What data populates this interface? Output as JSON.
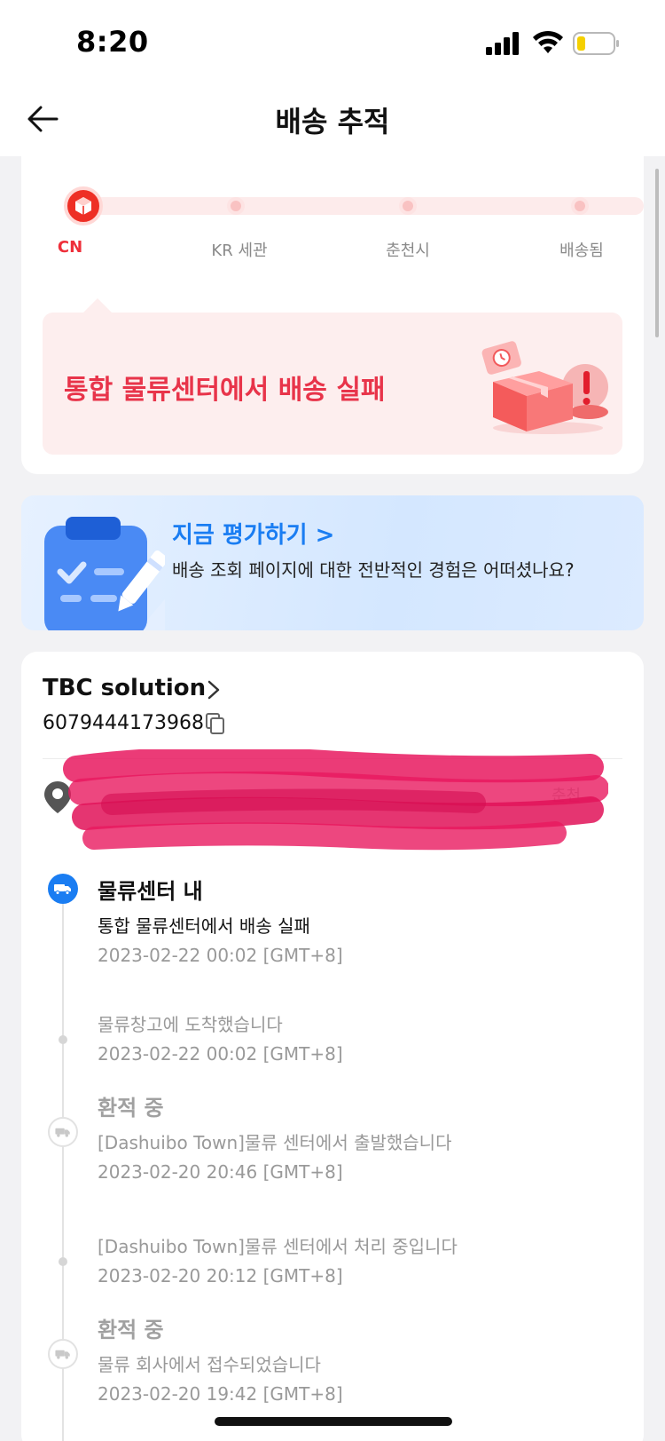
{
  "status_bar": {
    "time": "8:20"
  },
  "nav": {
    "title": "배송 추적"
  },
  "progress": {
    "steps": [
      "CN",
      "KR 세관",
      "춘천시",
      "배송됨"
    ],
    "status_message": "통합 물류센터에서 배송 실패"
  },
  "review": {
    "title": "지금 평가하기 >",
    "subtitle": "배송 조회 페이지에 대한 전반적인 경험은 어떠셨나요?"
  },
  "shipment": {
    "carrier": "TBC solution",
    "tracking_number": "6079444173968",
    "address_tail": "춘천"
  },
  "timeline": [
    {
      "title": "물류센터 내",
      "desc": "통합 물류센터에서 배송 실패",
      "time": "2023-02-22 00:02 [GMT+8]"
    },
    {
      "title": "",
      "desc": "물류창고에 도착했습니다",
      "time": "2023-02-22 00:02 [GMT+8]"
    },
    {
      "title": "환적 중",
      "desc": "[Dashuibo Town]물류 센터에서 출발했습니다",
      "time": "2023-02-20 20:46 [GMT+8]"
    },
    {
      "title": "",
      "desc": "[Dashuibo Town]물류 센터에서 처리 중입니다",
      "time": "2023-02-20 20:12 [GMT+8]"
    },
    {
      "title": "환적 중",
      "desc": "물류 회사에서 접수되었습니다",
      "time": "2023-02-20 19:42 [GMT+8]"
    }
  ],
  "colors": {
    "accent_red": "#ee2f3a",
    "accent_blue": "#1a7df2"
  }
}
